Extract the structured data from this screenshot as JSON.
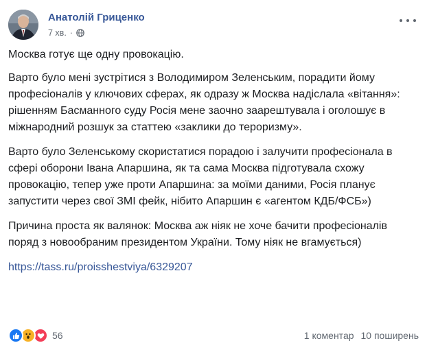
{
  "post": {
    "author": "Анатолій Гриценко",
    "time": "7 хв.",
    "privacy_icon": "globe-icon",
    "paragraphs": [
      "Москва готує ще одну провокацію.",
      "Варто було мені зустрітися з Володимиром Зеленським, порадити йому професіоналів у ключових сферах, як одразу ж Москва надіслала «вітання»: рішенням Басманного суду Росія мене заочно заарештувала і оголошує в міжнародний розшук за статтею «заклики до тероризму».",
      "Варто було Зеленському скористатися порадою і залучити професіонала в сфері оборони Івана Апаршина, як та сама Москва підготувала схожу провокацію, тепер уже проти Апаршина: за моїми даними, Росія планує запустити через свої ЗМІ фейк, нібито Апаршин є «агентом КДБ/ФСБ»)",
      "Причина проста як валянок: Москва аж ніяк не хоче бачити професіоналів поряд з новообраним президентом України. Тому ніяк не вгамується)"
    ],
    "link": "https://tass.ru/proisshestviya/6329207"
  },
  "footer": {
    "reactions": [
      "like-icon",
      "wow-icon",
      "love-icon"
    ],
    "reaction_count": "56",
    "comments": "1 коментар",
    "shares": "10 поширень"
  },
  "colors": {
    "link": "#385898",
    "meta": "#606770",
    "like": "#1877f2",
    "wow": "#f7b125",
    "love": "#f33e58"
  }
}
